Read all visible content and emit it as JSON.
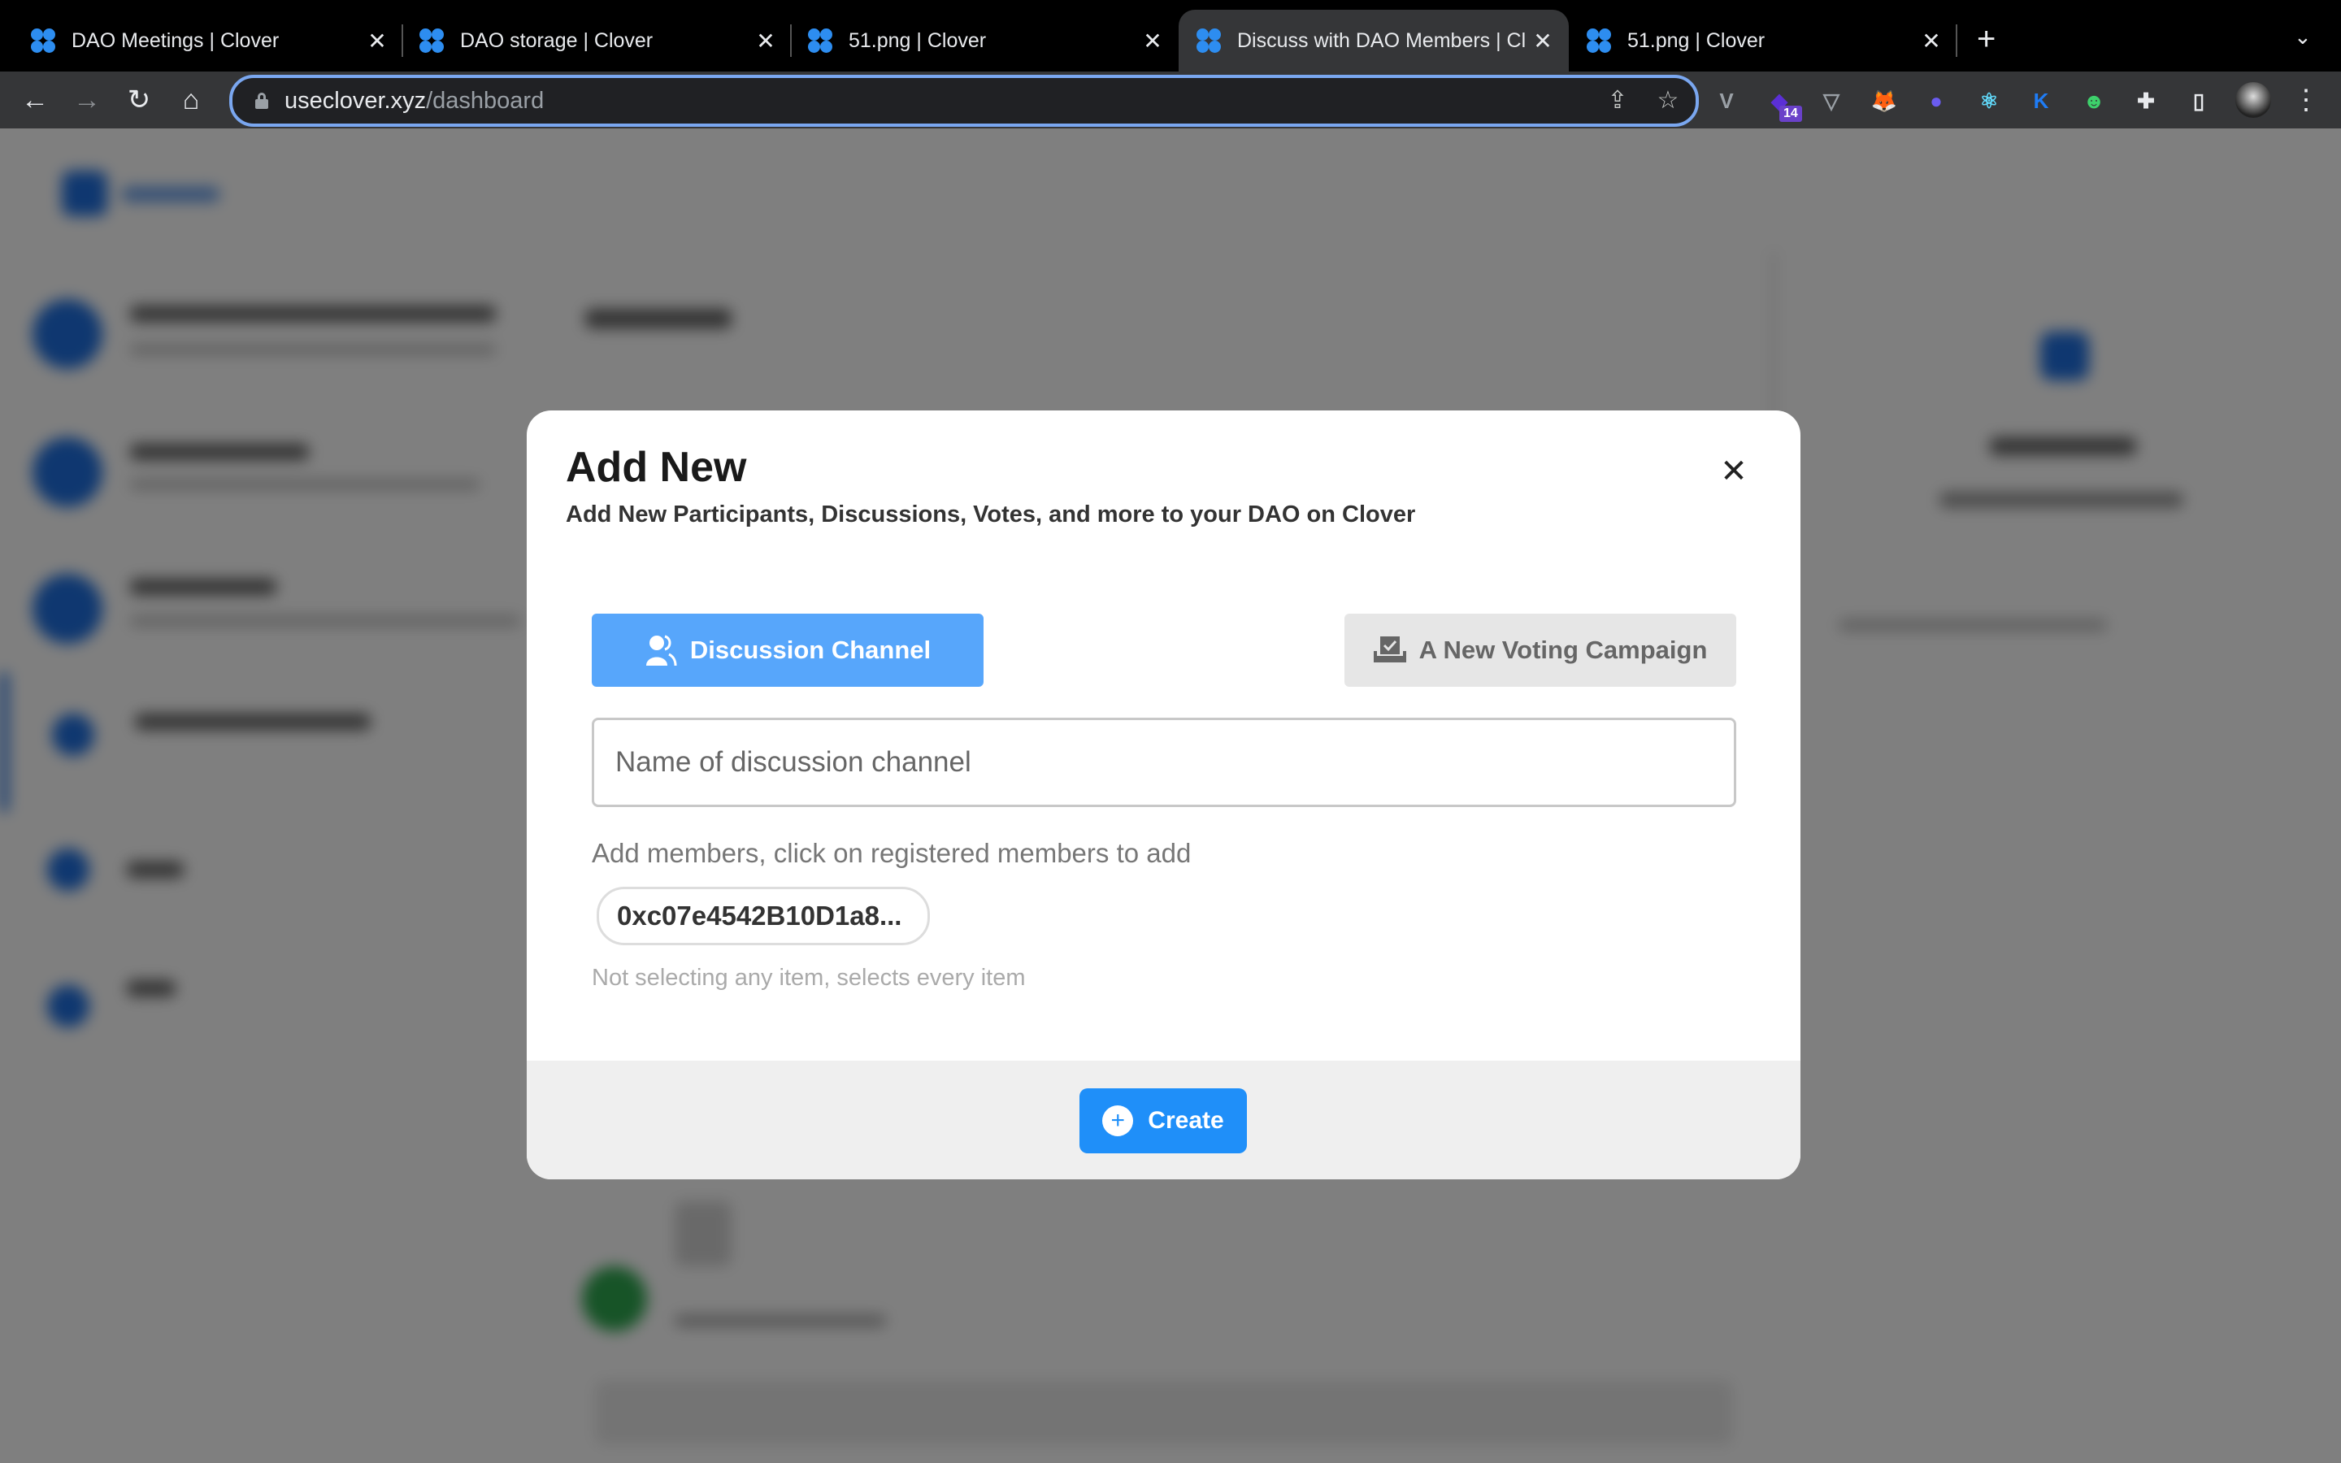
{
  "browser": {
    "tabs": [
      {
        "title": "DAO Meetings | Clover",
        "active": false
      },
      {
        "title": "DAO storage | Clover",
        "active": false
      },
      {
        "title": "51.png | Clover",
        "active": false
      },
      {
        "title": "Discuss with DAO Members | Clover",
        "active": true
      },
      {
        "title": "51.png | Clover",
        "active": false
      }
    ],
    "close_glyph": "✕",
    "new_tab_glyph": "+",
    "tab_menu_glyph": "⌄",
    "url": {
      "host": "useclover.xyz",
      "path": "/dashboard"
    },
    "nav": {
      "back": "←",
      "forward": "→",
      "reload": "↻",
      "home": "⌂"
    },
    "omnibox_icons": {
      "share": "⇪",
      "bookmark": "☆"
    },
    "extensions": [
      {
        "name": "vue-devtools",
        "glyph": "V",
        "color": "#9aa0a6"
      },
      {
        "name": "purple-extension",
        "glyph": "◆",
        "color": "#5b2fd6",
        "badge": "14"
      },
      {
        "name": "v-extension",
        "glyph": "▽",
        "color": "#9aa0a6"
      },
      {
        "name": "metamask",
        "glyph": "🦊",
        "color": "#e8821e"
      },
      {
        "name": "ghost-wallet",
        "glyph": "●",
        "color": "#6a5cf0"
      },
      {
        "name": "react-devtools",
        "glyph": "⚛",
        "color": "#61dafb"
      },
      {
        "name": "k-extension",
        "glyph": "K",
        "color": "#1f7cf5"
      },
      {
        "name": "frog-extension",
        "glyph": "☻",
        "color": "#3dd16b"
      },
      {
        "name": "extensions-puzzle",
        "glyph": "✚",
        "color": "#e8eaed"
      },
      {
        "name": "side-panel",
        "glyph": "▯",
        "color": "#e8eaed"
      }
    ],
    "menu_glyph": "⋮"
  },
  "modal": {
    "title": "Add New",
    "subtitle": "Add New Participants, Discussions, Votes, and more to your DAO on Clover",
    "close_glyph": "✕",
    "options": {
      "discussion": {
        "label": "Discussion Channel",
        "icon": "users-icon",
        "selected": true
      },
      "voting": {
        "label": "A New Voting Campaign",
        "icon": "ballot-icon",
        "selected": false
      }
    },
    "channel_name": {
      "value": "",
      "placeholder": "Name of discussion channel"
    },
    "members_label": "Add members, click on registered members to add",
    "members": [
      "0xc07e4542B10D1a8..."
    ],
    "hint": "Not selecting any item, selects every item",
    "create_label": "Create"
  },
  "colors": {
    "primary": "#1f8ff9",
    "selected_option": "#57a6fb",
    "unselected_option": "#e6e6e6",
    "overlay": "rgba(0,0,0,0.5)"
  }
}
